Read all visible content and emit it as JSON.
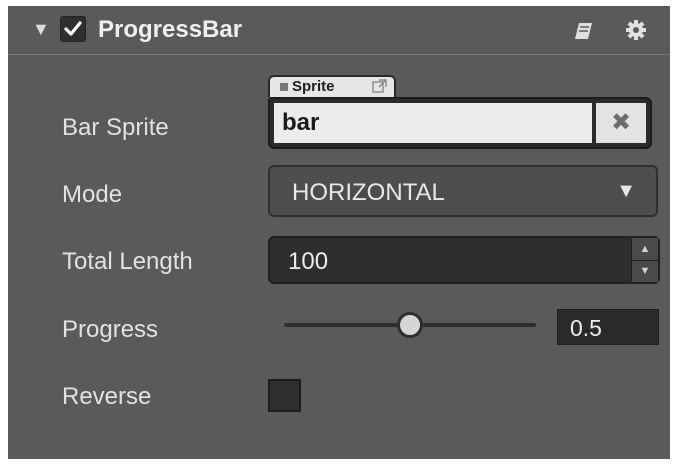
{
  "component": {
    "title": "ProgressBar",
    "enabled": true,
    "collapse_glyph": "▼",
    "icons": [
      "book-icon",
      "gear-icon"
    ]
  },
  "fields": {
    "bar_sprite": {
      "label": "Bar Sprite",
      "asset_type": "Sprite",
      "value": "bar",
      "clear_glyph": "✖"
    },
    "mode": {
      "label": "Mode",
      "value": "HORIZONTAL",
      "arrow_glyph": "▼"
    },
    "total_length": {
      "label": "Total Length",
      "value": "100",
      "up_glyph": "▲",
      "down_glyph": "▼"
    },
    "progress": {
      "label": "Progress",
      "value": "0.5",
      "fraction": 0.5
    },
    "reverse": {
      "label": "Reverse",
      "checked": false
    }
  },
  "colors": {
    "panel_bg": "#5a5a5a",
    "field_dark": "#2e2e2e",
    "text": "#e6e6e6"
  }
}
